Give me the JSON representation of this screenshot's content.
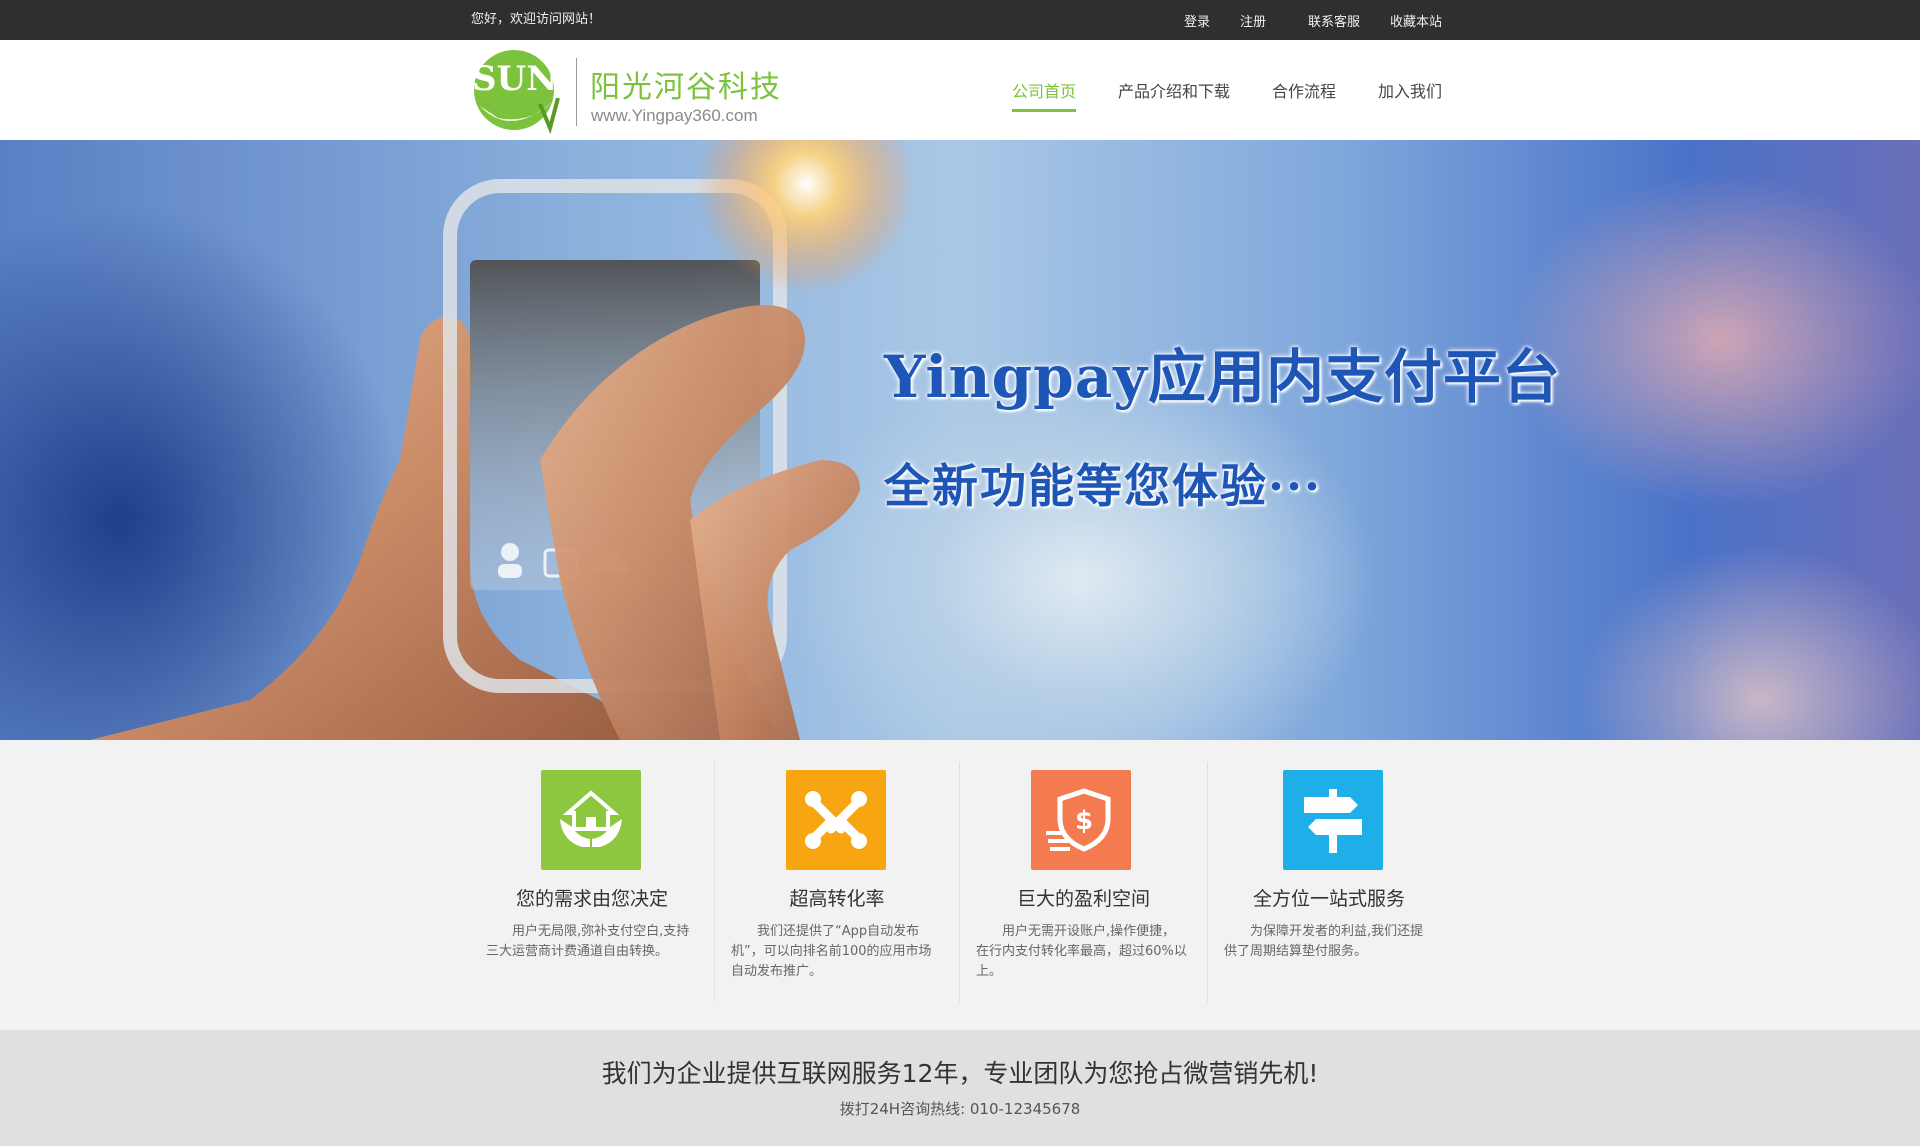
{
  "topbar": {
    "greeting": "您好，欢迎访问网站！",
    "links": [
      "登录",
      "注册",
      "联系客服",
      "收藏本站"
    ]
  },
  "header": {
    "logo_mark": "SUN",
    "logo_name": "阳光河谷科技",
    "logo_url": "www.Yingpay360.com",
    "nav": [
      {
        "label": "公司首页",
        "active": true
      },
      {
        "label": "产品介绍和下载",
        "active": false
      },
      {
        "label": "合作流程",
        "active": false
      },
      {
        "label": "加入我们",
        "active": false
      }
    ]
  },
  "banner": {
    "title": "Yingpay应用内支付平台",
    "subtitle": "全新功能等您体验···"
  },
  "features": [
    {
      "icon": "house-hands-icon",
      "color": "#8dc63f",
      "title": "您的需求由您决定",
      "desc": "用户无局限,弥补支付空白,支持三大运营商计费通道自由转换。"
    },
    {
      "icon": "joomla-knot-icon",
      "color": "#f7a511",
      "title": "超高转化率",
      "desc": "我们还提供了“App自动发布机”，可以向排名前100的应用市场自动发布推广。"
    },
    {
      "icon": "dollar-shield-icon",
      "color": "#f47b4f",
      "title": "巨大的盈利空间",
      "desc": "用户无需开设账户,操作便捷，在行内支付转化率最高，超过60%以上。"
    },
    {
      "icon": "signpost-icon",
      "color": "#1eaee8",
      "title": "全方位一站式服务",
      "desc": "为保障开发者的利益,我们还提供了周期结算垫付服务。"
    }
  ],
  "bottom": {
    "title": "我们为企业提供互联网服务12年，专业团队为您抢占微营销先机!",
    "phone": "拨打24H咨询热线: 010-12345678"
  }
}
